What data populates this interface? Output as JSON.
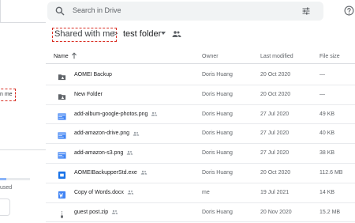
{
  "sidebar": {
    "selected_label": "n me",
    "storage_text": "used"
  },
  "search": {
    "placeholder": "Search in Drive"
  },
  "breadcrumb": {
    "root": "Shared with me",
    "separator": ">",
    "current": "test folder"
  },
  "table": {
    "headers": {
      "name": "Name",
      "owner": "Owner",
      "modified": "Last modified",
      "size": "File size"
    },
    "rows": [
      {
        "name": "AOMEI Backup",
        "icon": "folder-icon",
        "shared": false,
        "owner": "Doris Huang",
        "modified": "20 Oct 2020",
        "size": "—"
      },
      {
        "name": "New Folder",
        "icon": "folder-icon",
        "shared": false,
        "owner": "Doris Huang",
        "modified": "20 Oct 2020",
        "size": "—"
      },
      {
        "name": "add-album-google-photos.png",
        "icon": "image-icon",
        "shared": true,
        "owner": "Doris Huang",
        "modified": "27 Jul 2020",
        "size": "49 KB"
      },
      {
        "name": "add-amazon-drive.png",
        "icon": "image-icon",
        "shared": true,
        "owner": "Doris Huang",
        "modified": "27 Jul 2020",
        "size": "40 KB"
      },
      {
        "name": "add-amazon-s3.png",
        "icon": "image-icon",
        "shared": true,
        "owner": "Doris Huang",
        "modified": "27 Jul 2020",
        "size": "38 KB"
      },
      {
        "name": "AOMEIBackupperStd.exe",
        "icon": "exe-icon",
        "shared": true,
        "owner": "Doris Huang",
        "modified": "20 Oct 2020",
        "size": "112.6 MB"
      },
      {
        "name": "Copy of Words.docx",
        "icon": "word-icon",
        "shared": true,
        "owner": "me",
        "modified": "19 Jul 2021",
        "size": "14 KB"
      },
      {
        "name": "guest post.zip",
        "icon": "zip-icon",
        "shared": true,
        "owner": "Doris Huang",
        "modified": "20 Nov 2020",
        "size": "15.2 MB"
      }
    ]
  },
  "colors": {
    "highlight_dash": "#d93025",
    "folder": "#5f6368",
    "image": "#4285f4",
    "word": "#4285f4"
  }
}
